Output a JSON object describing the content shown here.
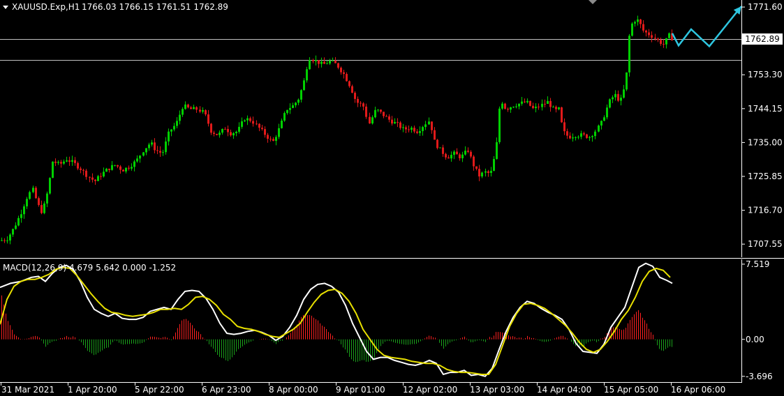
{
  "chart_data": [
    {
      "type": "candlestick",
      "symbol_label": "XAUUSD.Exp,H1",
      "ohlc_label": "1766.03 1766.15 1761.51 1762.89",
      "last_price_label": "1762.89",
      "ylim": [
        1704.0,
        1773.5
      ],
      "y_ticks": [
        "1771.60",
        "1762.89",
        "1753.30",
        "1744.15",
        "1735.00",
        "1725.85",
        "1716.70",
        "1707.55"
      ],
      "x_ticks": [
        "31 Mar 2021",
        "1 Apr 20:00",
        "5 Apr 22:00",
        "6 Apr 23:00",
        "8 Apr 00:00",
        "9 Apr 01:00",
        "12 Apr 02:00",
        "13 Apr 03:00",
        "14 Apr 04:00",
        "15 Apr 05:00",
        "16 Apr 06:00"
      ],
      "horizontal_levels": [
        1762.89,
        1757.3
      ],
      "price_path": [
        [
          0,
          1708.5
        ],
        [
          10,
          1709
        ],
        [
          20,
          1712
        ],
        [
          30,
          1716
        ],
        [
          38,
          1720
        ],
        [
          46,
          1722.5
        ],
        [
          54,
          1718
        ],
        [
          60,
          1716
        ],
        [
          68,
          1722
        ],
        [
          75,
          1730
        ],
        [
          85,
          1729
        ],
        [
          95,
          1730.5
        ],
        [
          105,
          1729.5
        ],
        [
          115,
          1728
        ],
        [
          125,
          1726
        ],
        [
          135,
          1724.5
        ],
        [
          145,
          1726.5
        ],
        [
          155,
          1728
        ],
        [
          165,
          1729
        ],
        [
          175,
          1727.5
        ],
        [
          185,
          1728.5
        ],
        [
          195,
          1730
        ],
        [
          205,
          1733
        ],
        [
          215,
          1735
        ],
        [
          222,
          1733
        ],
        [
          232,
          1732
        ],
        [
          242,
          1738
        ],
        [
          252,
          1740
        ],
        [
          262,
          1745
        ],
        [
          272,
          1744
        ],
        [
          282,
          1744
        ],
        [
          292,
          1743
        ],
        [
          302,
          1738
        ],
        [
          312,
          1737
        ],
        [
          322,
          1739
        ],
        [
          330,
          1737.5
        ],
        [
          340,
          1738
        ],
        [
          350,
          1741.5
        ],
        [
          360,
          1741
        ],
        [
          370,
          1739
        ],
        [
          380,
          1737
        ],
        [
          390,
          1735
        ],
        [
          400,
          1739
        ],
        [
          410,
          1744
        ],
        [
          420,
          1745
        ],
        [
          428,
          1747
        ],
        [
          436,
          1752
        ],
        [
          442,
          1758
        ],
        [
          452,
          1757
        ],
        [
          462,
          1756
        ],
        [
          472,
          1757
        ],
        [
          482,
          1756
        ],
        [
          492,
          1753.5
        ],
        [
          502,
          1750
        ],
        [
          510,
          1746
        ],
        [
          520,
          1745
        ],
        [
          528,
          1740
        ],
        [
          538,
          1744
        ],
        [
          548,
          1742.5
        ],
        [
          558,
          1741
        ],
        [
          568,
          1740
        ],
        [
          578,
          1738.5
        ],
        [
          588,
          1739
        ],
        [
          598,
          1738
        ],
        [
          608,
          1740
        ],
        [
          615,
          1741
        ],
        [
          622,
          1735
        ],
        [
          630,
          1733
        ],
        [
          640,
          1731
        ],
        [
          650,
          1732
        ],
        [
          660,
          1731
        ],
        [
          670,
          1733
        ],
        [
          678,
          1729
        ],
        [
          686,
          1726
        ],
        [
          694,
          1727
        ],
        [
          702,
          1726.5
        ],
        [
          710,
          1733
        ],
        [
          716,
          1747
        ],
        [
          724,
          1744
        ],
        [
          734,
          1745
        ],
        [
          744,
          1745.5
        ],
        [
          754,
          1746
        ],
        [
          764,
          1744
        ],
        [
          774,
          1745
        ],
        [
          784,
          1746
        ],
        [
          794,
          1743.5
        ],
        [
          800,
          1744
        ],
        [
          806,
          1738
        ],
        [
          814,
          1736.5
        ],
        [
          824,
          1737
        ],
        [
          834,
          1737
        ],
        [
          844,
          1736.5
        ],
        [
          852,
          1738
        ],
        [
          860,
          1740
        ],
        [
          866,
          1743
        ],
        [
          872,
          1746
        ],
        [
          880,
          1748
        ],
        [
          888,
          1746
        ],
        [
          896,
          1751
        ],
        [
          902,
          1766
        ],
        [
          908,
          1768
        ],
        [
          914,
          1768
        ],
        [
          922,
          1765
        ],
        [
          932,
          1764
        ],
        [
          942,
          1762.5
        ],
        [
          950,
          1761.5
        ],
        [
          958,
          1764
        ],
        [
          963,
          1762.89
        ]
      ],
      "projection_path": [
        [
          963,
          1764.5
        ],
        [
          972,
          1761.2
        ],
        [
          990,
          1765.6
        ],
        [
          1016,
          1761.0
        ],
        [
          1062,
          1771.8
        ]
      ],
      "colors": {
        "bull": "#00d000",
        "bear": "#e11a1a",
        "grid": "#c0c0c0",
        "arrow": "#2ec6e0"
      }
    },
    {
      "type": "macd",
      "label": "MACD(12,26,9) 4.679 5.642 0.000 -1.252",
      "ylim": [
        -4.2,
        8.0
      ],
      "y_ticks": [
        "7.519",
        "0.00",
        "-3.696"
      ],
      "macd_line": [
        [
          0,
          5.2
        ],
        [
          15,
          5.6
        ],
        [
          30,
          5.8
        ],
        [
          45,
          6.2
        ],
        [
          55,
          6.3
        ],
        [
          65,
          5.8
        ],
        [
          75,
          6.6
        ],
        [
          85,
          7.2
        ],
        [
          95,
          7.4
        ],
        [
          105,
          7.0
        ],
        [
          115,
          5.8
        ],
        [
          125,
          4.2
        ],
        [
          135,
          3.0
        ],
        [
          145,
          2.6
        ],
        [
          155,
          2.3
        ],
        [
          165,
          2.6
        ],
        [
          175,
          2.1
        ],
        [
          185,
          2.0
        ],
        [
          195,
          2.0
        ],
        [
          205,
          2.2
        ],
        [
          215,
          2.8
        ],
        [
          225,
          3.0
        ],
        [
          235,
          3.2
        ],
        [
          245,
          3.0
        ],
        [
          255,
          4.0
        ],
        [
          265,
          4.8
        ],
        [
          275,
          4.9
        ],
        [
          285,
          4.8
        ],
        [
          295,
          4.1
        ],
        [
          305,
          3.0
        ],
        [
          315,
          1.6
        ],
        [
          325,
          0.6
        ],
        [
          335,
          0.5
        ],
        [
          345,
          0.6
        ],
        [
          355,
          0.8
        ],
        [
          365,
          0.9
        ],
        [
          375,
          0.7
        ],
        [
          385,
          0.4
        ],
        [
          395,
          -0.1
        ],
        [
          405,
          0.3
        ],
        [
          415,
          1.2
        ],
        [
          425,
          2.4
        ],
        [
          435,
          4.0
        ],
        [
          445,
          5.0
        ],
        [
          455,
          5.5
        ],
        [
          465,
          5.6
        ],
        [
          475,
          5.3
        ],
        [
          485,
          4.7
        ],
        [
          495,
          3.4
        ],
        [
          505,
          1.6
        ],
        [
          515,
          0.2
        ],
        [
          525,
          -1.2
        ],
        [
          535,
          -2.0
        ],
        [
          545,
          -1.8
        ],
        [
          555,
          -1.8
        ],
        [
          565,
          -2.1
        ],
        [
          575,
          -2.3
        ],
        [
          585,
          -2.5
        ],
        [
          595,
          -2.6
        ],
        [
          605,
          -2.4
        ],
        [
          615,
          -2.1
        ],
        [
          625,
          -2.4
        ],
        [
          635,
          -3.5
        ],
        [
          645,
          -3.3
        ],
        [
          655,
          -3.3
        ],
        [
          665,
          -3.1
        ],
        [
          675,
          -3.6
        ],
        [
          685,
          -3.5
        ],
        [
          695,
          -3.7
        ],
        [
          705,
          -2.9
        ],
        [
          715,
          -1.0
        ],
        [
          725,
          0.8
        ],
        [
          735,
          2.2
        ],
        [
          745,
          3.2
        ],
        [
          755,
          3.8
        ],
        [
          765,
          3.6
        ],
        [
          775,
          3.1
        ],
        [
          785,
          2.7
        ],
        [
          795,
          2.4
        ],
        [
          805,
          2.0
        ],
        [
          815,
          1.0
        ],
        [
          825,
          -0.4
        ],
        [
          835,
          -1.2
        ],
        [
          845,
          -1.3
        ],
        [
          855,
          -1.4
        ],
        [
          865,
          -0.5
        ],
        [
          875,
          1.2
        ],
        [
          885,
          2.2
        ],
        [
          895,
          3.2
        ],
        [
          905,
          5.2
        ],
        [
          915,
          7.2
        ],
        [
          925,
          7.6
        ],
        [
          935,
          7.3
        ],
        [
          945,
          6.2
        ],
        [
          955,
          5.9
        ],
        [
          963,
          5.6
        ]
      ],
      "signal_line": [
        [
          0,
          1.5
        ],
        [
          10,
          4.0
        ],
        [
          20,
          5.3
        ],
        [
          30,
          5.8
        ],
        [
          40,
          6.0
        ],
        [
          50,
          6.0
        ],
        [
          60,
          6.2
        ],
        [
          70,
          6.5
        ],
        [
          80,
          7.0
        ],
        [
          90,
          7.2
        ],
        [
          100,
          7.1
        ],
        [
          110,
          6.4
        ],
        [
          120,
          5.5
        ],
        [
          130,
          4.6
        ],
        [
          140,
          3.8
        ],
        [
          150,
          3.1
        ],
        [
          160,
          2.7
        ],
        [
          170,
          2.6
        ],
        [
          180,
          2.4
        ],
        [
          190,
          2.3
        ],
        [
          200,
          2.4
        ],
        [
          210,
          2.5
        ],
        [
          220,
          2.7
        ],
        [
          230,
          3.0
        ],
        [
          240,
          3.0
        ],
        [
          250,
          3.1
        ],
        [
          260,
          3.0
        ],
        [
          270,
          3.5
        ],
        [
          280,
          4.2
        ],
        [
          290,
          4.3
        ],
        [
          300,
          4.0
        ],
        [
          310,
          3.4
        ],
        [
          320,
          2.5
        ],
        [
          330,
          2.0
        ],
        [
          340,
          1.3
        ],
        [
          350,
          1.1
        ],
        [
          360,
          1.0
        ],
        [
          370,
          0.8
        ],
        [
          380,
          0.5
        ],
        [
          390,
          0.3
        ],
        [
          400,
          0.2
        ],
        [
          410,
          0.6
        ],
        [
          420,
          1.0
        ],
        [
          430,
          1.6
        ],
        [
          440,
          2.7
        ],
        [
          450,
          3.7
        ],
        [
          460,
          4.5
        ],
        [
          470,
          4.9
        ],
        [
          480,
          5.0
        ],
        [
          490,
          4.6
        ],
        [
          500,
          3.8
        ],
        [
          510,
          2.6
        ],
        [
          520,
          1.0
        ],
        [
          530,
          0.0
        ],
        [
          540,
          -1.0
        ],
        [
          550,
          -1.6
        ],
        [
          560,
          -1.8
        ],
        [
          570,
          -1.9
        ],
        [
          580,
          -2.0
        ],
        [
          590,
          -2.2
        ],
        [
          600,
          -2.3
        ],
        [
          610,
          -2.4
        ],
        [
          620,
          -2.4
        ],
        [
          630,
          -2.6
        ],
        [
          640,
          -3.0
        ],
        [
          650,
          -3.2
        ],
        [
          660,
          -3.3
        ],
        [
          670,
          -3.3
        ],
        [
          680,
          -3.4
        ],
        [
          690,
          -3.5
        ],
        [
          700,
          -3.5
        ],
        [
          710,
          -2.5
        ],
        [
          720,
          -0.6
        ],
        [
          730,
          1.3
        ],
        [
          740,
          2.6
        ],
        [
          750,
          3.5
        ],
        [
          760,
          3.6
        ],
        [
          770,
          3.4
        ],
        [
          780,
          3.1
        ],
        [
          790,
          2.6
        ],
        [
          800,
          2.0
        ],
        [
          810,
          1.4
        ],
        [
          820,
          0.6
        ],
        [
          830,
          -0.3
        ],
        [
          840,
          -1.0
        ],
        [
          850,
          -1.3
        ],
        [
          860,
          -1.0
        ],
        [
          870,
          -0.2
        ],
        [
          880,
          0.8
        ],
        [
          890,
          2.0
        ],
        [
          900,
          2.9
        ],
        [
          910,
          4.2
        ],
        [
          920,
          5.8
        ],
        [
          930,
          6.8
        ],
        [
          940,
          7.1
        ],
        [
          950,
          6.9
        ],
        [
          960,
          6.2
        ]
      ],
      "colors": {
        "macd": "#ffffff",
        "signal": "#e8e000",
        "hist_pos": "#ff2020",
        "hist_neg": "#1aa01a"
      }
    }
  ]
}
